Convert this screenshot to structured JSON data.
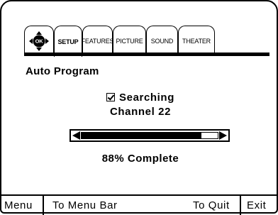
{
  "tabs": {
    "ok_icon": "ok-navigation-icon",
    "items": [
      {
        "label": "SETUP",
        "active": true
      },
      {
        "label": "FEATURES",
        "active": false
      },
      {
        "label": "PICTURE",
        "active": false
      },
      {
        "label": "SOUND",
        "active": false
      },
      {
        "label": "THEATER",
        "active": false
      }
    ]
  },
  "page": {
    "heading": "Auto Program",
    "status_line1": "Searching",
    "status_line2": "Channel 22",
    "progress_fraction": 0.88,
    "progress_label": "88% Complete"
  },
  "footer": {
    "menu": "Menu",
    "menu_bar": "To Menu Bar",
    "quit": "To Quit",
    "exit": "Exit"
  }
}
